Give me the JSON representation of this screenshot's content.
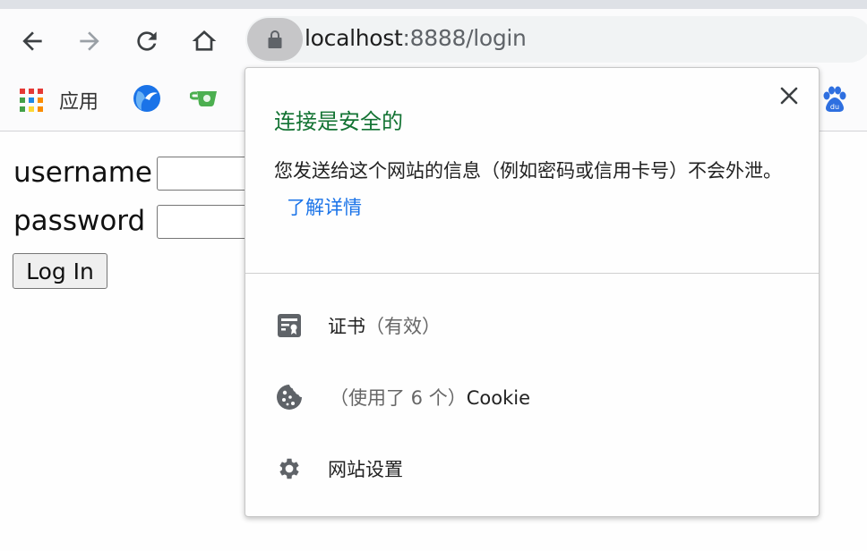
{
  "browser": {
    "nav": {
      "back_icon": "arrow-left-icon",
      "forward_icon": "arrow-right-icon",
      "reload_icon": "reload-icon",
      "home_icon": "home-icon"
    },
    "omnibox": {
      "lock_icon": "lock-icon",
      "url_host": "localhost",
      "url_rest": ":8888/login"
    },
    "bookmarks": [
      {
        "icon": "apps-grid-icon",
        "label": "应用"
      },
      {
        "icon": "blue-circle-logo-icon",
        "label": ""
      },
      {
        "icon": "green-teacup-logo-icon",
        "label": ""
      },
      {
        "icon": "baidu-paw-icon",
        "label": ""
      }
    ]
  },
  "page": {
    "username_label": "username",
    "password_label": "password",
    "username_value": "",
    "password_value": "",
    "login_button": "Log In"
  },
  "site_info_popup": {
    "title": "连接是安全的",
    "description": "您发送给这个网站的信息（例如密码或信用卡号）不会外泄。",
    "learn_more": "了解详情",
    "close_icon": "close-icon",
    "colors": {
      "title": "#137333",
      "link": "#1a73e8"
    },
    "items": [
      {
        "icon": "certificate-icon",
        "label": "证书",
        "detail": "（有效）"
      },
      {
        "icon": "cookie-icon",
        "label": "Cookie",
        "detail": "（使用了 6 个）"
      },
      {
        "icon": "gear-icon",
        "label": "网站设置",
        "detail": ""
      }
    ]
  }
}
